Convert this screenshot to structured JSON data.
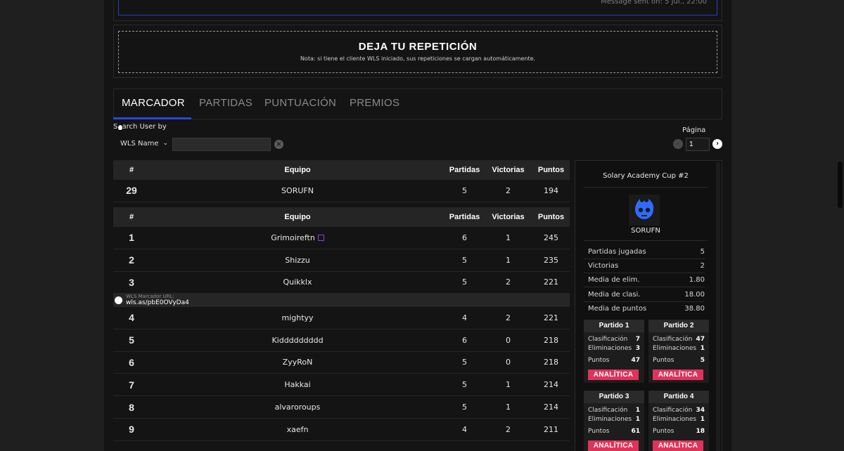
{
  "message": {
    "sent_text": "Message sent on: 5 Jul., 22:00"
  },
  "replay": {
    "title": "DEJA TU REPETICIÓN",
    "note": "Nota: si tiene el cliente WLS iniciado, sus repeticiones se cargan automáticamente."
  },
  "tabs": [
    {
      "label": "MARCADOR",
      "active": true
    },
    {
      "label": "PARTIDAS",
      "active": false
    },
    {
      "label": "PUNTUACIÓN",
      "active": false
    },
    {
      "label": "PREMIOS",
      "active": false
    }
  ],
  "search": {
    "label": "Search User by",
    "select_value": "WLS Name",
    "input_value": ""
  },
  "pagination": {
    "label": "Página",
    "current": "1"
  },
  "table": {
    "headers": {
      "rank": "#",
      "team": "Equipo",
      "matches": "Partidas",
      "wins": "Victorias",
      "points": "Puntos"
    },
    "own_row": {
      "rank": "29",
      "team": "SORUFN",
      "matches": "5",
      "wins": "2",
      "points": "194"
    },
    "rows": [
      {
        "rank": "1",
        "team": "Grimoireftn",
        "matches": "6",
        "wins": "1",
        "points": "245"
      },
      {
        "rank": "2",
        "team": "Shizzu",
        "matches": "5",
        "wins": "1",
        "points": "235"
      },
      {
        "rank": "3",
        "team": "Quikklx",
        "matches": "5",
        "wins": "2",
        "points": "221"
      },
      {
        "rank": "4",
        "team": "mightyy",
        "matches": "4",
        "wins": "2",
        "points": "221"
      },
      {
        "rank": "5",
        "team": "Kiddddddddd",
        "matches": "6",
        "wins": "0",
        "points": "218"
      },
      {
        "rank": "6",
        "team": "ZyyRoN",
        "matches": "5",
        "wins": "0",
        "points": "218"
      },
      {
        "rank": "7",
        "team": "Hakkai",
        "matches": "5",
        "wins": "1",
        "points": "214"
      },
      {
        "rank": "8",
        "team": "alvaroroups",
        "matches": "5",
        "wins": "1",
        "points": "214"
      },
      {
        "rank": "9",
        "team": "xaefn",
        "matches": "4",
        "wins": "2",
        "points": "211"
      }
    ],
    "url_caption": "WLS Marcador URL:",
    "url": "wls.as/pbE0OVyDa4"
  },
  "detail": {
    "tournament": "Solary Academy Cup #2",
    "team": "SORUFN",
    "stats": [
      {
        "label": "Partidas jugadas",
        "value": "5"
      },
      {
        "label": "Victorias",
        "value": "2"
      },
      {
        "label": "Media de elim.",
        "value": "1.80"
      },
      {
        "label": "Media de clasi.",
        "value": "18.00"
      },
      {
        "label": "Media de puntos",
        "value": "38.80"
      }
    ],
    "matches": [
      {
        "title": "Partido 1",
        "place_label": "Clasificación",
        "place": "7",
        "elim_label": "Eliminaciones",
        "elims": "3",
        "pts_label": "Puntos",
        "pts": "47",
        "button": "ANALÍTICA"
      },
      {
        "title": "Partido 2",
        "place_label": "Clasificación",
        "place": "47",
        "elim_label": "Eliminaciones",
        "elims": "1",
        "pts_label": "Puntos",
        "pts": "5",
        "button": "ANALÍTICA"
      },
      {
        "title": "Partido 3",
        "place_label": "Clasificación",
        "place": "1",
        "elim_label": "Eliminaciones",
        "elims": "1",
        "pts_label": "Puntos",
        "pts": "61",
        "button": "ANALÍTICA"
      },
      {
        "title": "Partido 4",
        "place_label": "Clasificación",
        "place": "34",
        "elim_label": "Eliminaciones",
        "elims": "1",
        "pts_label": "Puntos",
        "pts": "18",
        "button": "ANALÍTICA"
      }
    ]
  },
  "colors": {
    "accent": "#2748d8",
    "analytics_button": "#e0335a",
    "twitch": "#8e44d8",
    "logo": "#2f6bff"
  }
}
